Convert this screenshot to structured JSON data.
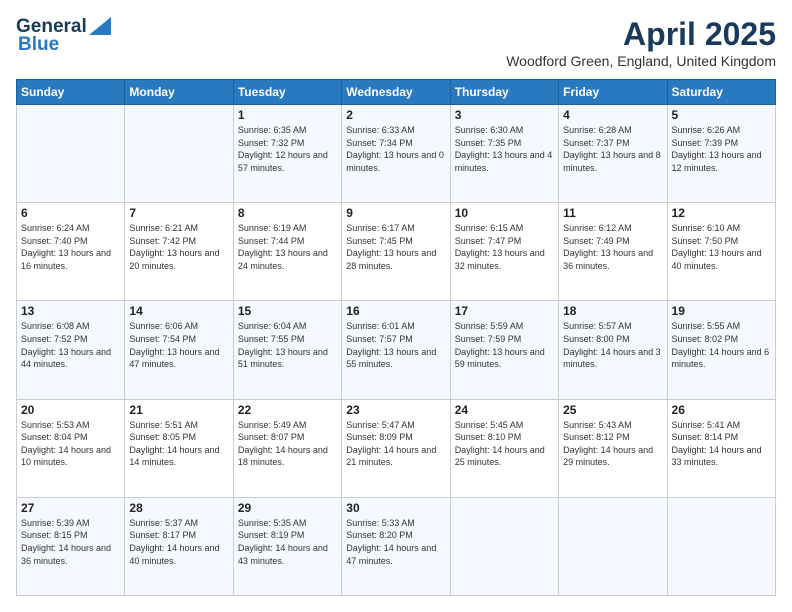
{
  "header": {
    "logo_line1": "General",
    "logo_line2": "Blue",
    "month": "April 2025",
    "location": "Woodford Green, England, United Kingdom"
  },
  "weekdays": [
    "Sunday",
    "Monday",
    "Tuesday",
    "Wednesday",
    "Thursday",
    "Friday",
    "Saturday"
  ],
  "weeks": [
    [
      {
        "day": "",
        "detail": ""
      },
      {
        "day": "",
        "detail": ""
      },
      {
        "day": "1",
        "detail": "Sunrise: 6:35 AM\nSunset: 7:32 PM\nDaylight: 12 hours and 57 minutes."
      },
      {
        "day": "2",
        "detail": "Sunrise: 6:33 AM\nSunset: 7:34 PM\nDaylight: 13 hours and 0 minutes."
      },
      {
        "day": "3",
        "detail": "Sunrise: 6:30 AM\nSunset: 7:35 PM\nDaylight: 13 hours and 4 minutes."
      },
      {
        "day": "4",
        "detail": "Sunrise: 6:28 AM\nSunset: 7:37 PM\nDaylight: 13 hours and 8 minutes."
      },
      {
        "day": "5",
        "detail": "Sunrise: 6:26 AM\nSunset: 7:39 PM\nDaylight: 13 hours and 12 minutes."
      }
    ],
    [
      {
        "day": "6",
        "detail": "Sunrise: 6:24 AM\nSunset: 7:40 PM\nDaylight: 13 hours and 16 minutes."
      },
      {
        "day": "7",
        "detail": "Sunrise: 6:21 AM\nSunset: 7:42 PM\nDaylight: 13 hours and 20 minutes."
      },
      {
        "day": "8",
        "detail": "Sunrise: 6:19 AM\nSunset: 7:44 PM\nDaylight: 13 hours and 24 minutes."
      },
      {
        "day": "9",
        "detail": "Sunrise: 6:17 AM\nSunset: 7:45 PM\nDaylight: 13 hours and 28 minutes."
      },
      {
        "day": "10",
        "detail": "Sunrise: 6:15 AM\nSunset: 7:47 PM\nDaylight: 13 hours and 32 minutes."
      },
      {
        "day": "11",
        "detail": "Sunrise: 6:12 AM\nSunset: 7:49 PM\nDaylight: 13 hours and 36 minutes."
      },
      {
        "day": "12",
        "detail": "Sunrise: 6:10 AM\nSunset: 7:50 PM\nDaylight: 13 hours and 40 minutes."
      }
    ],
    [
      {
        "day": "13",
        "detail": "Sunrise: 6:08 AM\nSunset: 7:52 PM\nDaylight: 13 hours and 44 minutes."
      },
      {
        "day": "14",
        "detail": "Sunrise: 6:06 AM\nSunset: 7:54 PM\nDaylight: 13 hours and 47 minutes."
      },
      {
        "day": "15",
        "detail": "Sunrise: 6:04 AM\nSunset: 7:55 PM\nDaylight: 13 hours and 51 minutes."
      },
      {
        "day": "16",
        "detail": "Sunrise: 6:01 AM\nSunset: 7:57 PM\nDaylight: 13 hours and 55 minutes."
      },
      {
        "day": "17",
        "detail": "Sunrise: 5:59 AM\nSunset: 7:59 PM\nDaylight: 13 hours and 59 minutes."
      },
      {
        "day": "18",
        "detail": "Sunrise: 5:57 AM\nSunset: 8:00 PM\nDaylight: 14 hours and 3 minutes."
      },
      {
        "day": "19",
        "detail": "Sunrise: 5:55 AM\nSunset: 8:02 PM\nDaylight: 14 hours and 6 minutes."
      }
    ],
    [
      {
        "day": "20",
        "detail": "Sunrise: 5:53 AM\nSunset: 8:04 PM\nDaylight: 14 hours and 10 minutes."
      },
      {
        "day": "21",
        "detail": "Sunrise: 5:51 AM\nSunset: 8:05 PM\nDaylight: 14 hours and 14 minutes."
      },
      {
        "day": "22",
        "detail": "Sunrise: 5:49 AM\nSunset: 8:07 PM\nDaylight: 14 hours and 18 minutes."
      },
      {
        "day": "23",
        "detail": "Sunrise: 5:47 AM\nSunset: 8:09 PM\nDaylight: 14 hours and 21 minutes."
      },
      {
        "day": "24",
        "detail": "Sunrise: 5:45 AM\nSunset: 8:10 PM\nDaylight: 14 hours and 25 minutes."
      },
      {
        "day": "25",
        "detail": "Sunrise: 5:43 AM\nSunset: 8:12 PM\nDaylight: 14 hours and 29 minutes."
      },
      {
        "day": "26",
        "detail": "Sunrise: 5:41 AM\nSunset: 8:14 PM\nDaylight: 14 hours and 33 minutes."
      }
    ],
    [
      {
        "day": "27",
        "detail": "Sunrise: 5:39 AM\nSunset: 8:15 PM\nDaylight: 14 hours and 36 minutes."
      },
      {
        "day": "28",
        "detail": "Sunrise: 5:37 AM\nSunset: 8:17 PM\nDaylight: 14 hours and 40 minutes."
      },
      {
        "day": "29",
        "detail": "Sunrise: 5:35 AM\nSunset: 8:19 PM\nDaylight: 14 hours and 43 minutes."
      },
      {
        "day": "30",
        "detail": "Sunrise: 5:33 AM\nSunset: 8:20 PM\nDaylight: 14 hours and 47 minutes."
      },
      {
        "day": "",
        "detail": ""
      },
      {
        "day": "",
        "detail": ""
      },
      {
        "day": "",
        "detail": ""
      }
    ]
  ]
}
